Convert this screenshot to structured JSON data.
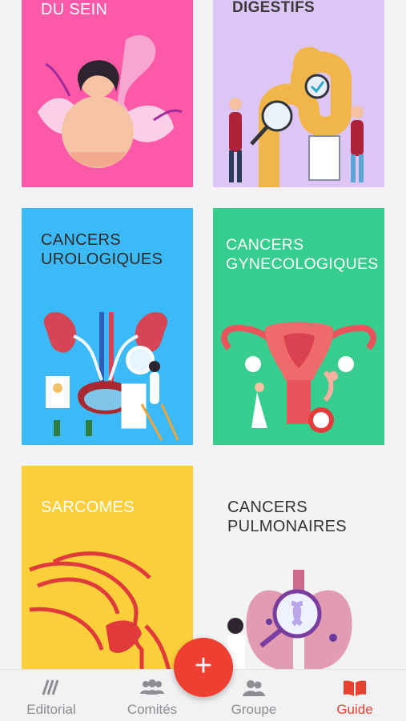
{
  "cards": [
    {
      "title": "DU SEIN",
      "color": "#fc59a8"
    },
    {
      "title": "DIGESTIFS",
      "color": "#ddc6f5"
    },
    {
      "title": "CANCERS\nUROLOGIQUES",
      "color": "#3bbaf7"
    },
    {
      "title": "CANCERS\nGYNECOLOGIQUES",
      "color": "#37cd8e"
    },
    {
      "title": "SARCOMES",
      "color": "#fdcf3a"
    },
    {
      "title": "CANCERS\nPULMONAIRES",
      "color": "#f3f3f3"
    }
  ],
  "tabs": [
    {
      "label": "Editorial",
      "icon": "editorial-icon"
    },
    {
      "label": "Comités",
      "icon": "committees-icon"
    },
    {
      "label": "Groupe",
      "icon": "group-icon"
    },
    {
      "label": "Guide",
      "icon": "book-icon",
      "active": true
    }
  ],
  "fab": {
    "label": "+",
    "icon": "plus-icon"
  },
  "colors": {
    "accent": "#ef3f33",
    "inactive": "#8d8d92"
  }
}
